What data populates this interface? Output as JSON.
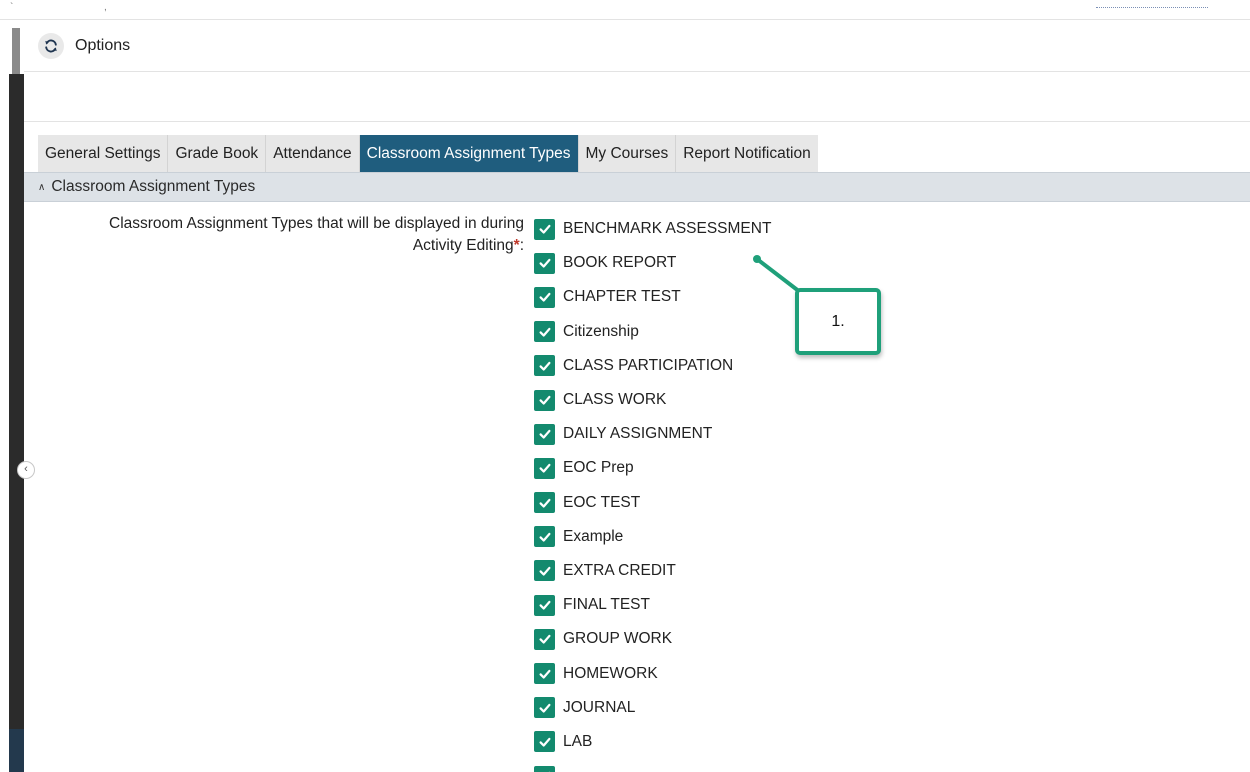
{
  "header": {
    "title": "Options"
  },
  "tabs": [
    {
      "label": "General Settings",
      "active": false
    },
    {
      "label": "Grade Book",
      "active": false
    },
    {
      "label": "Attendance",
      "active": false
    },
    {
      "label": "Classroom Assignment Types",
      "active": true
    },
    {
      "label": "My Courses",
      "active": false
    },
    {
      "label": "Report Notification",
      "active": false
    }
  ],
  "section": {
    "title": "Classroom Assignment Types"
  },
  "field": {
    "label_line1": "Classroom Assignment Types that will be displayed in during",
    "label_line2": "Activity Editing",
    "required_mark": "*",
    "label_suffix": ":"
  },
  "items": [
    {
      "label": "BENCHMARK ASSESSMENT",
      "checked": true
    },
    {
      "label": "BOOK REPORT",
      "checked": true
    },
    {
      "label": "CHAPTER TEST",
      "checked": true
    },
    {
      "label": "Citizenship",
      "checked": true
    },
    {
      "label": "CLASS PARTICIPATION",
      "checked": true
    },
    {
      "label": "CLASS WORK",
      "checked": true
    },
    {
      "label": "DAILY ASSIGNMENT",
      "checked": true
    },
    {
      "label": "EOC Prep",
      "checked": true
    },
    {
      "label": "EOC TEST",
      "checked": true
    },
    {
      "label": "Example",
      "checked": true
    },
    {
      "label": "EXTRA CREDIT",
      "checked": true
    },
    {
      "label": "FINAL TEST",
      "checked": true
    },
    {
      "label": "GROUP WORK",
      "checked": true
    },
    {
      "label": "HOMEWORK",
      "checked": true
    },
    {
      "label": "JOURNAL",
      "checked": true
    },
    {
      "label": "LAB",
      "checked": true
    },
    {
      "label": "",
      "checked": true
    }
  ],
  "callout": {
    "label": "1."
  },
  "colors": {
    "accent": "#138a6e",
    "active_tab": "#1f5d7e",
    "callout": "#1fa07a",
    "required": "#c0392b"
  },
  "icons": {
    "refresh": "refresh-icon",
    "collapse": "chevron-left-icon",
    "section": "chevron-up-icon",
    "check": "checkmark-icon"
  }
}
